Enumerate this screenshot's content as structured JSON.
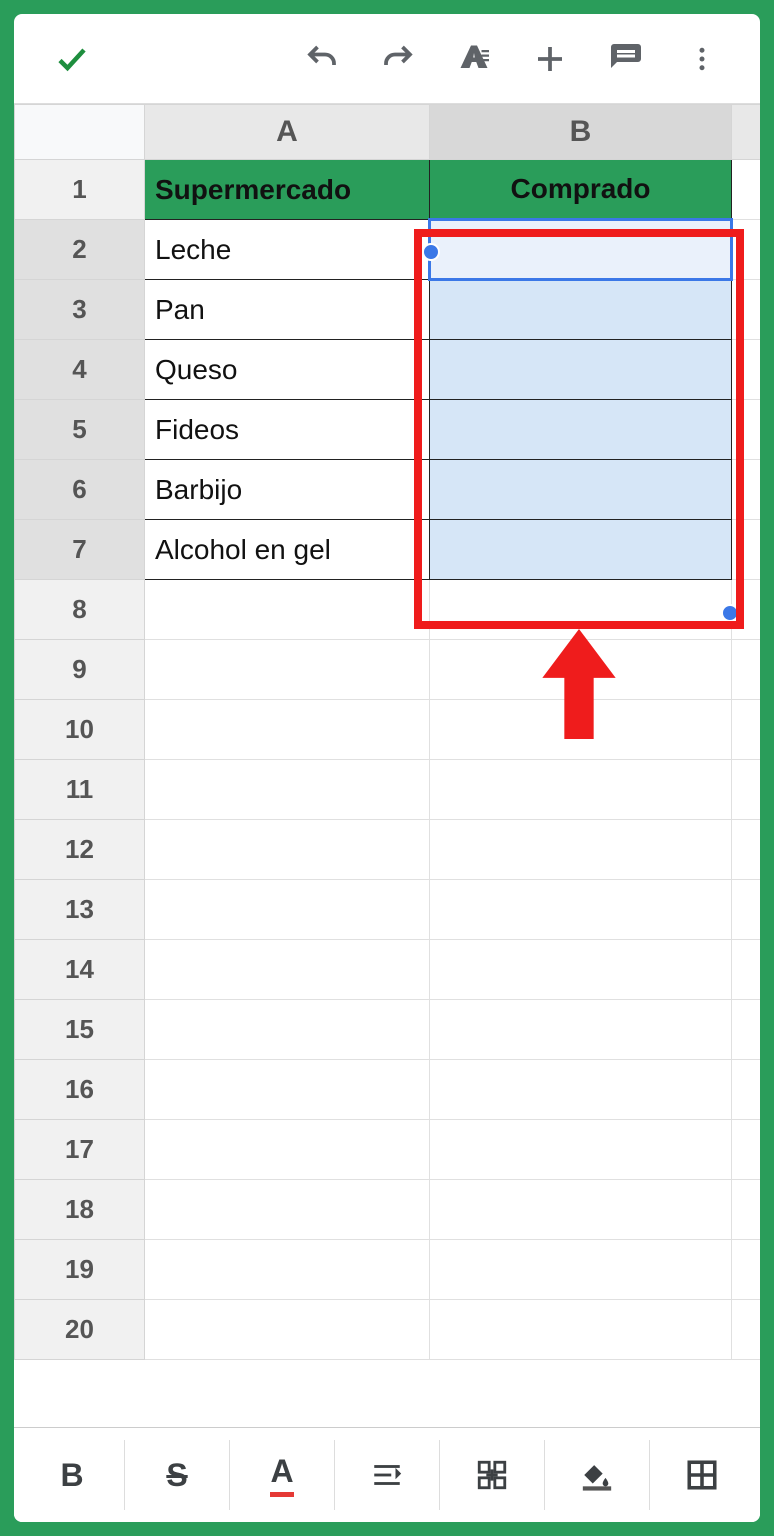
{
  "toolbar": {
    "accept_icon": "check",
    "undo_icon": "undo",
    "redo_icon": "redo",
    "text_format_icon": "text-format",
    "insert_icon": "plus",
    "comment_icon": "comment",
    "more_icon": "more-vert"
  },
  "columns": {
    "A": "A",
    "B": "B"
  },
  "rows": [
    "1",
    "2",
    "3",
    "4",
    "5",
    "6",
    "7",
    "8",
    "9",
    "10",
    "11",
    "12",
    "13",
    "14",
    "15",
    "16",
    "17",
    "18",
    "19",
    "20"
  ],
  "headers": {
    "colA": "Supermercado",
    "colB": "Comprado"
  },
  "items": [
    {
      "a": "Leche",
      "b": ""
    },
    {
      "a": "Pan",
      "b": ""
    },
    {
      "a": "Queso",
      "b": ""
    },
    {
      "a": "Fideos",
      "b": ""
    },
    {
      "a": "Barbijo",
      "b": ""
    },
    {
      "a": "Alcohol en gel",
      "b": ""
    }
  ],
  "selection": {
    "range": "B2:B7",
    "active": "B2"
  },
  "bottom_toolbar": {
    "bold": "B",
    "strike": "S",
    "text_color": "A",
    "align_icon": "align-left",
    "cell_merge_icon": "merge",
    "fill_color_icon": "fill",
    "borders_icon": "borders"
  }
}
